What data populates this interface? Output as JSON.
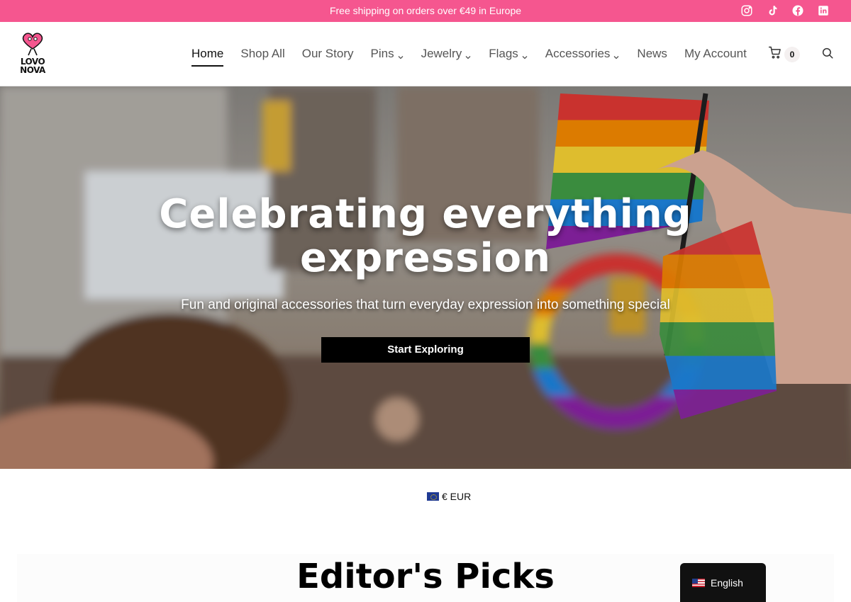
{
  "topbar": {
    "announcement": "Free shipping on orders over €49 in Europe",
    "social_icons": [
      "instagram-icon",
      "tiktok-icon",
      "facebook-icon",
      "linkedin-icon"
    ],
    "background": "#f5568f"
  },
  "header": {
    "logo_text_line1": "LOVO",
    "logo_text_line2": "NOVA",
    "nav": [
      {
        "label": "Home",
        "active": true,
        "dropdown": false
      },
      {
        "label": "Shop All",
        "active": false,
        "dropdown": false
      },
      {
        "label": "Our Story",
        "active": false,
        "dropdown": false
      },
      {
        "label": "Pins",
        "active": false,
        "dropdown": true
      },
      {
        "label": "Jewelry",
        "active": false,
        "dropdown": true
      },
      {
        "label": "Flags",
        "active": false,
        "dropdown": true
      },
      {
        "label": "Accessories",
        "active": false,
        "dropdown": true
      },
      {
        "label": "News",
        "active": false,
        "dropdown": false
      },
      {
        "label": "My Account",
        "active": false,
        "dropdown": false
      }
    ],
    "cart_count": "0"
  },
  "hero": {
    "title_line1": "Celebrating everything",
    "title_line2": "expression",
    "subtitle": "Fun and original accessories that turn everyday expression into something special",
    "cta_label": "Start Exploring"
  },
  "currency": {
    "label": "€ EUR"
  },
  "picks": {
    "title": "Editor's Picks"
  },
  "language": {
    "label": "English"
  },
  "colors": {
    "accent": "#f5568f",
    "button": "#000000"
  }
}
